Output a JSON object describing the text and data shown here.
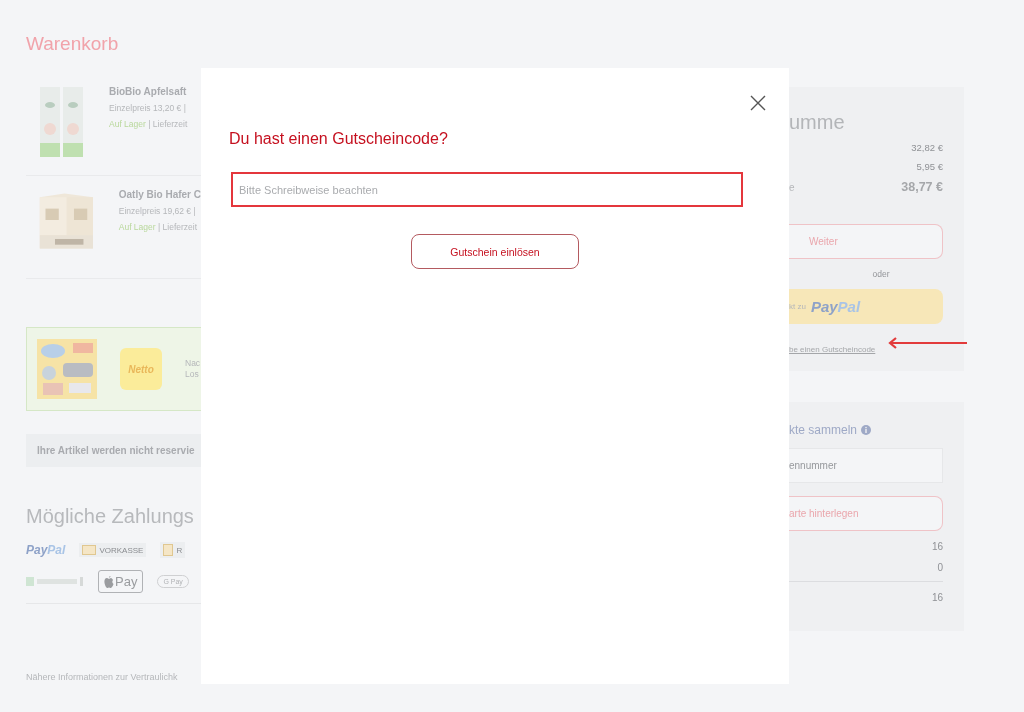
{
  "page": {
    "title": "Warenkorb"
  },
  "cart_items": [
    {
      "name": "BioBio Apfelsaft",
      "unit_price": "Einzelpreis 13,20 € |",
      "stock": "Auf Lager",
      "delivery": "| Lieferzeit"
    },
    {
      "name": "Oatly Bio Hafer C",
      "unit_price": "Einzelpreis 19,62 € |",
      "stock": "Auf Lager",
      "delivery": "| Lieferzeit"
    }
  ],
  "promo_banner": {
    "logo": "Netto",
    "text_lines": [
      "Nac",
      "Los"
    ]
  },
  "notice": "Ihre Artikel werden nicht reservie",
  "payment": {
    "title": "Mögliche Zahlungs",
    "methods": [
      {
        "kind": "paypal",
        "parts": [
          "Pay",
          "Pal"
        ]
      },
      {
        "kind": "vorkasse",
        "label": "VORKASSE"
      },
      {
        "kind": "invoice",
        "label": "R"
      },
      {
        "kind": "consors"
      },
      {
        "kind": "applepay",
        "label": "Pay"
      },
      {
        "kind": "gpay",
        "label": "G Pay"
      }
    ]
  },
  "footer_text": "Nähere Informationen zur Vertraulichk",
  "summary": {
    "title": "umme",
    "rows": [
      {
        "kind": "line",
        "value": "32,82 €"
      },
      {
        "kind": "line",
        "value": "5,95 €"
      },
      {
        "kind": "total",
        "label": "e",
        "value": "38,77 €"
      }
    ],
    "continue_button": "Weiter",
    "separator": "oder",
    "paypal_button": {
      "prefix": "kt zu",
      "parts": [
        "Pay",
        "Pal"
      ]
    },
    "voucher_link": "be einen Gutscheincode"
  },
  "loyalty": {
    "title": "kte sammeln",
    "card_field": {
      "placeholder": "ennummer"
    },
    "button": "arte hinterlegen",
    "points": [
      "16",
      "0"
    ],
    "total": "16"
  },
  "modal": {
    "title": "Du hast einen Gutscheincode?",
    "code_field": {
      "placeholder": "Bitte Schreibweise beachten"
    },
    "submit": "Gutschein einlösen"
  }
}
